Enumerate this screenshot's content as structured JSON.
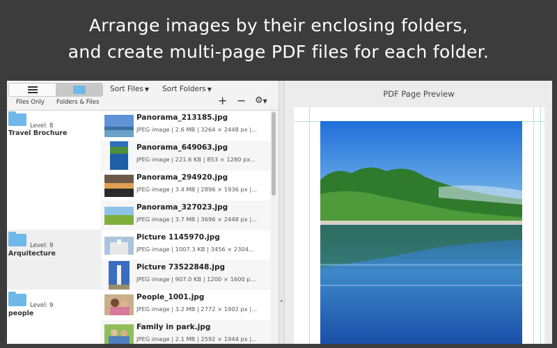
{
  "headline": {
    "line1": "Arrange images by their enclosing folders,",
    "line2": "and create multi-page PDF files for each folder."
  },
  "toolbar": {
    "files_only_label": "Files Only",
    "folders_files_label": "Folders & Files",
    "sort_files_label": "Sort Files",
    "sort_folders_label": "Sort Folders",
    "add_label": "+",
    "remove_label": "−",
    "settings_icon": "gear-icon"
  },
  "groups": [
    {
      "level": "Level: 8",
      "name": "Travel Brochure"
    },
    {
      "level": "Level: 9",
      "name": "Arquitecture"
    },
    {
      "level": "Level: 9",
      "name": "people"
    }
  ],
  "files": [
    {
      "name": "Panorama_213185.jpg",
      "meta": "JPEG image | 2.6 MB | 3264 × 2448 px |..."
    },
    {
      "name": "Panorama_649063.jpg",
      "meta": "JPEG image | 221.6 KB | 853 × 1280 px..."
    },
    {
      "name": "Panorama_294920.jpg",
      "meta": "JPEG image | 3.4 MB | 2896 × 1936 px |..."
    },
    {
      "name": "Panorama_327023.jpg",
      "meta": "JPEG image | 3.7 MB | 3696 × 2448 px |..."
    },
    {
      "name": "Picture 1145970.jpg",
      "meta": "JPEG image | 1007.3 KB | 3456 × 2304..."
    },
    {
      "name": "Picture 73522848.jpg",
      "meta": "JPEG image | 907.0 KB | 1200 × 1600 p..."
    },
    {
      "name": "People_1001.jpg",
      "meta": "JPEG image | 3.2 MB | 2772 × 1902 px |..."
    },
    {
      "name": "Family in park.jpg",
      "meta": "JPEG image | 2.1 MB | 2592 × 1944 px |..."
    }
  ],
  "preview": {
    "title": "PDF Page Preview"
  },
  "colors": {
    "background": "#3c3c3c",
    "folder": "#6fb8ea",
    "guide": "#b8e0d6"
  }
}
